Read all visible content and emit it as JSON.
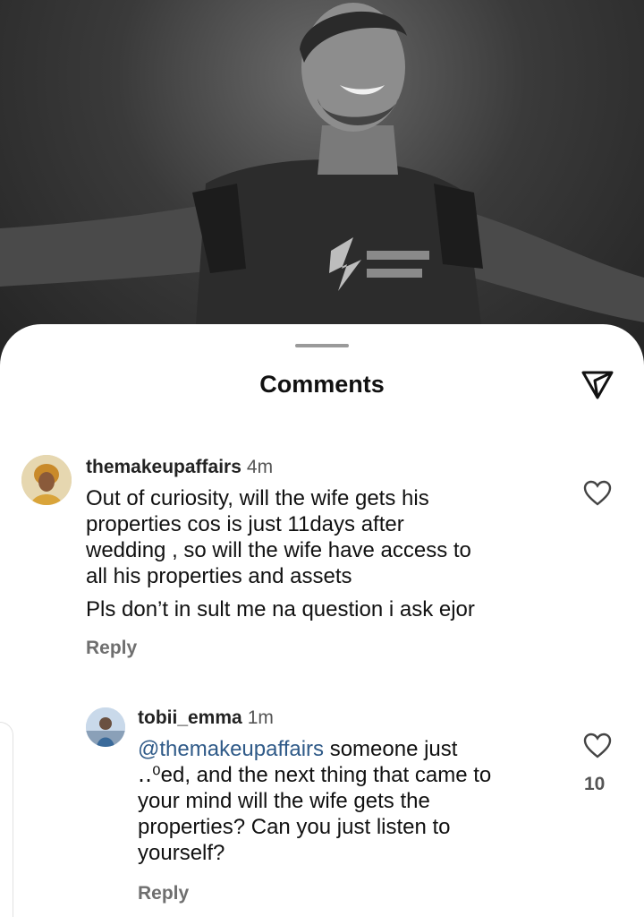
{
  "sheet": {
    "title": "Comments"
  },
  "icons": {
    "share": "send-icon",
    "like": "heart-icon"
  },
  "comments": [
    {
      "username": "themakeupaffairs",
      "time": "4m",
      "lines": [
        "Out of curiosity, will the wife gets his",
        "properties cos is just 11days after",
        "wedding , so will the wife have access to",
        "all his properties and assets",
        "Pls don’t in sult me na question i ask ejor"
      ],
      "reply_label": "Reply"
    },
    {
      "username": "tobii_emma",
      "time": "1m",
      "mention": "@themakeupaffairs",
      "first_line_rest": " someone just",
      "lines": [
        "‥⁰ed, and the next thing that came to",
        "your mind will the wife gets the",
        "properties? Can you just listen to",
        "yourself?"
      ],
      "likes": "10",
      "reply_label": "Reply"
    }
  ],
  "colors": {
    "mention": "#2f5a88",
    "secondary_text": "#6f6f6f"
  }
}
